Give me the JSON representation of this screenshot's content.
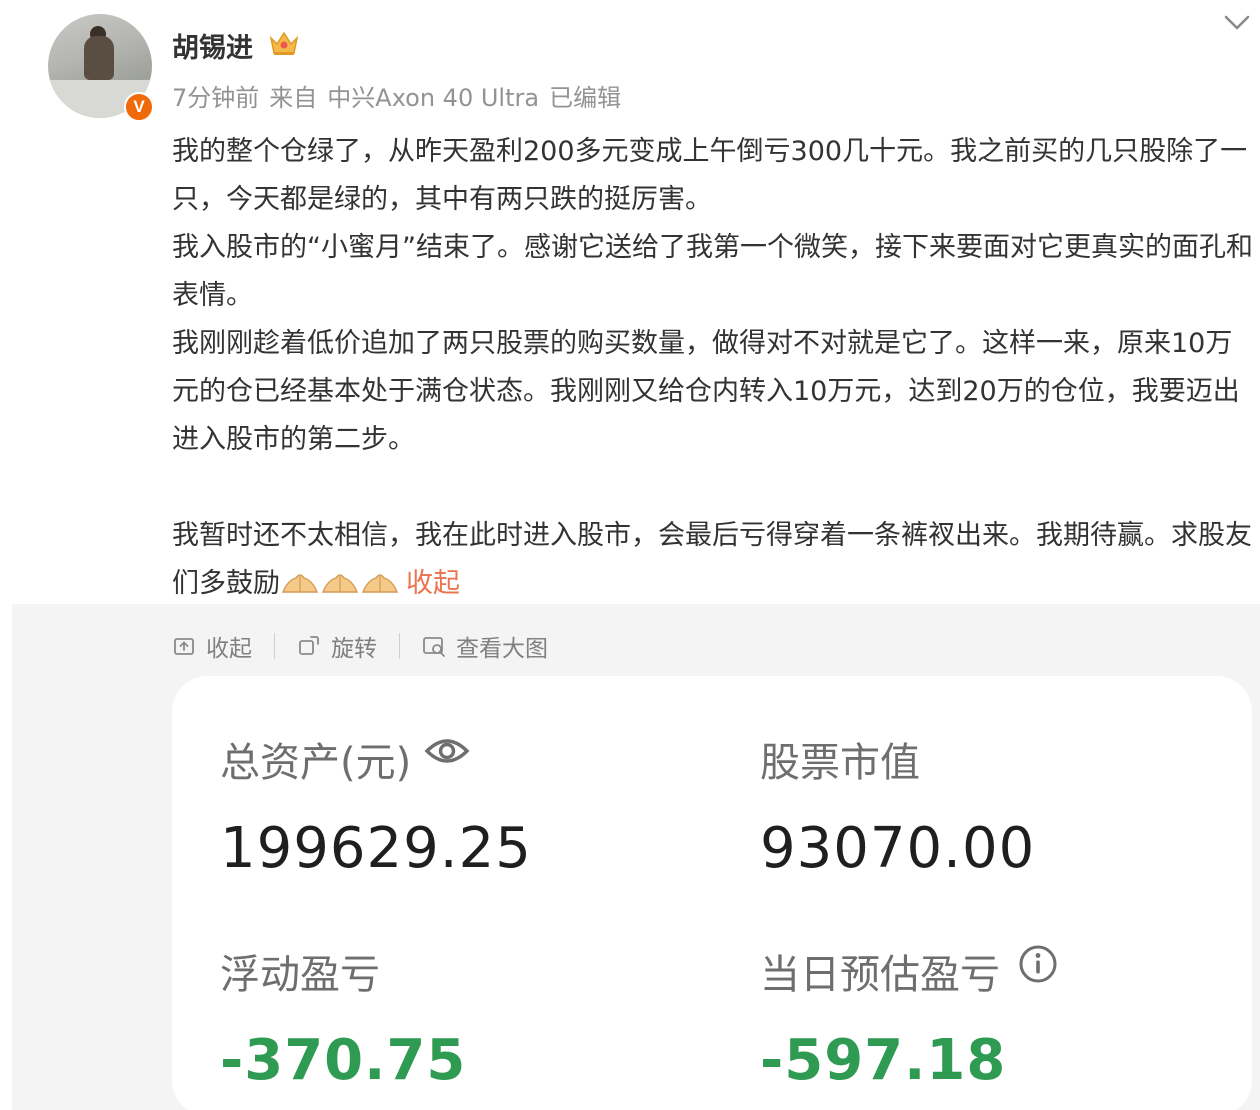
{
  "post": {
    "username": "胡锡进",
    "meta": {
      "time": "7分钟前",
      "source_prefix": "来自",
      "device": "中兴Axon 40 Ultra",
      "edited": "已编辑"
    },
    "paragraphs": [
      "我的整个仓绿了，从昨天盈利200多元变成上午倒亏300几十元。我之前买的几只股除了一只，今天都是绿的，其中有两只跌的挺厉害。",
      "我入股市的“小蜜月”结束了。感谢它送给了我第一个微笑，接下来要面对它更真实的面孔和表情。",
      "我刚刚趁着低价追加了两只股票的购买数量，做得对不对就是它了。这样一来，原来10万元的仓已经基本处于满仓状态。我刚刚又给仓内转入10万元，达到20万的仓位，我要迈出进入股市的第二步。"
    ],
    "last_paragraph": "我暂时还不太相信，我在此时进入股市，会最后亏得穿着一条裤衩出来。我期待赢。求股友们多鼓励",
    "collapse_link": "收起"
  },
  "toolbar": {
    "collapse": "收起",
    "rotate": "旋转",
    "view_large": "查看大图"
  },
  "card": {
    "total_assets_label": "总资产(元)",
    "total_assets_value": "199629.25",
    "market_value_label": "股票市值",
    "market_value_value": "93070.00",
    "floating_pl_label": "浮动盈亏",
    "floating_pl_value": "-370.75",
    "daily_pl_label": "当日预估盈亏",
    "daily_pl_value": "-597.18"
  },
  "icons": {
    "badge": "verified-v-badge",
    "crown": "crown-icon",
    "chevron": "chevron-down-icon",
    "eye": "eye-icon",
    "info": "info-icon"
  },
  "colors": {
    "link": "#eb7350",
    "negative": "#2f9a52",
    "badge": "#f06a0a"
  }
}
